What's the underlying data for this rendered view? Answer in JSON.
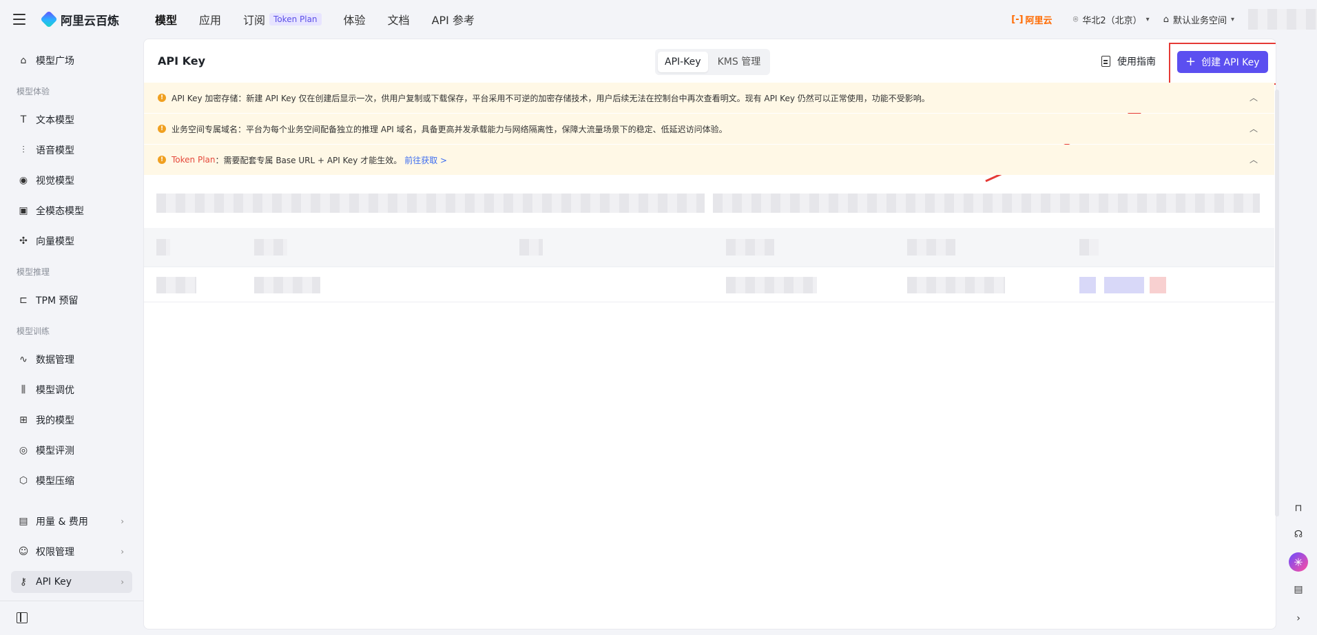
{
  "header": {
    "logo_text": "阿里云百炼",
    "nav": [
      {
        "label": "模型",
        "active": true
      },
      {
        "label": "应用"
      },
      {
        "label": "订阅",
        "badge": "Token Plan"
      },
      {
        "label": "体验"
      },
      {
        "label": "文档"
      },
      {
        "label": "API 参考"
      }
    ],
    "aliyun_label": "阿里云",
    "region": "华北2（北京）",
    "workspace": "默认业务空间"
  },
  "sidebar": {
    "items": [
      {
        "label": "模型广场",
        "icon": "model-market-icon",
        "glyph": "⌂"
      },
      {
        "label": "文本模型",
        "icon": "text-model-icon",
        "glyph": "T"
      },
      {
        "label": "语音模型",
        "icon": "voice-model-icon",
        "glyph": "⫶"
      },
      {
        "label": "视觉模型",
        "icon": "camera-icon",
        "glyph": "◉"
      },
      {
        "label": "全模态模型",
        "icon": "omni-model-icon",
        "glyph": "▣"
      },
      {
        "label": "向量模型",
        "icon": "vector-model-icon",
        "glyph": "✣"
      },
      {
        "label": "TPM 预留",
        "icon": "tpm-icon",
        "glyph": "⊏"
      },
      {
        "label": "数据管理",
        "icon": "chart-icon",
        "glyph": "∿"
      },
      {
        "label": "模型调优",
        "icon": "tuning-icon",
        "glyph": "⫼"
      },
      {
        "label": "我的模型",
        "icon": "grid-icon",
        "glyph": "⊞"
      },
      {
        "label": "模型评测",
        "icon": "compass-icon",
        "glyph": "◎"
      },
      {
        "label": "模型压缩",
        "icon": "compress-icon",
        "glyph": "⬡"
      },
      {
        "label": "用量 & 费用",
        "icon": "bill-icon",
        "glyph": "▤"
      },
      {
        "label": "权限管理",
        "icon": "user-icon",
        "glyph": "☺"
      },
      {
        "label": "API Key",
        "icon": "key-icon",
        "glyph": "⚷"
      }
    ],
    "groups": [
      "模型体验",
      "模型推理",
      "模型训练"
    ]
  },
  "main": {
    "title": "API Key",
    "tabs": [
      {
        "label": "API-Key",
        "active": true
      },
      {
        "label": "KMS 管理"
      }
    ],
    "guide_label": "使用指南",
    "create_label": "创建 API Key",
    "alerts": [
      {
        "strong": "API Key 加密存储：",
        "text": "新建 API Key 仅在创建后显示一次，供用户复制或下载保存，平台采用不可逆的加密存储技术，用户后续无法在控制台中再次查看明文。现有 API Key 仍然可以正常使用，功能不受影响。"
      },
      {
        "strong": "业务空间专属域名：",
        "text": "平台为每个业务空间配备独立的推理 API 域名，具备更高并发承载能力与网络隔离性，保障大流量场景下的稳定、低延迟访问体验。"
      },
      {
        "token": "Token Plan",
        "text": "：需要配套专属 Base URL + API Key 才能生效。",
        "link": "前往获取 >"
      }
    ]
  },
  "colors": {
    "primary": "#5b4ff0",
    "alert_bg": "#fff8e6",
    "highlight": "#e53935"
  }
}
